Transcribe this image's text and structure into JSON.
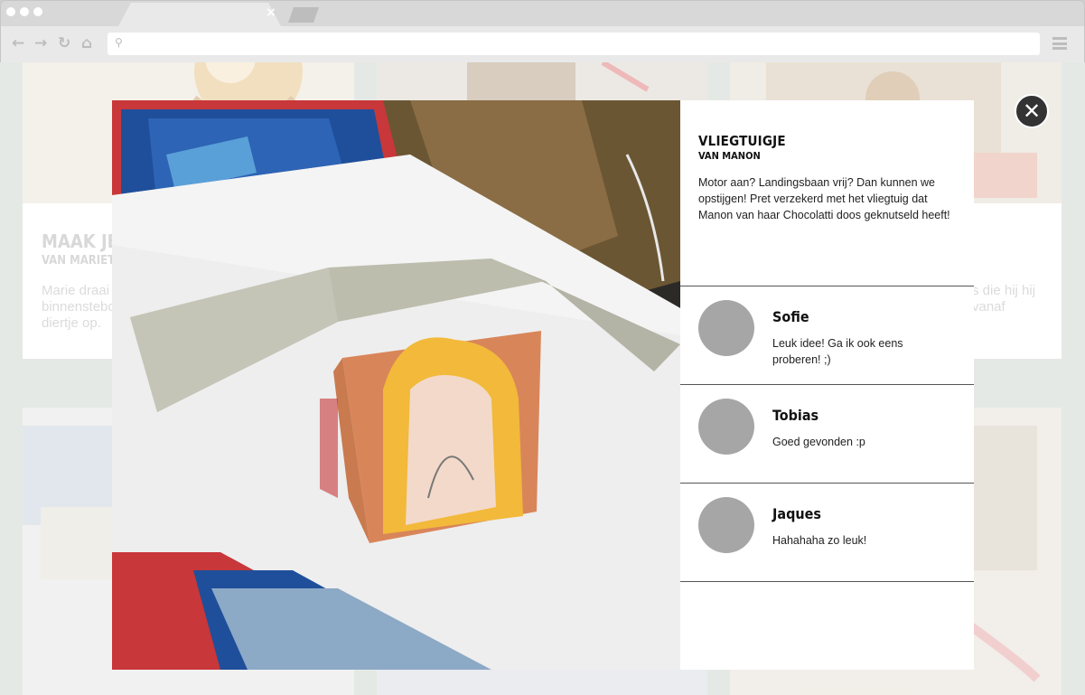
{
  "browser": {
    "tab_close_glyph": "×",
    "address_value": "",
    "nav_icons": [
      "back-icon",
      "forward-icon",
      "reload-icon",
      "home-icon"
    ]
  },
  "background": {
    "cards": [
      {
        "title": "Maak je v",
        "author": "van Marietje",
        "text": "Marie draai binnenstebo diertje op."
      },
      {
        "title": "",
        "author": "",
        "text": "s die hij hij vanaf"
      }
    ]
  },
  "modal": {
    "title": "Vliegtuigje",
    "author": "van Manon",
    "description": "Motor aan? Landingsbaan vrij? Dan kunnen we opstijgen! Pret verzekerd met het vliegtuig dat Manon van haar Chocolatti doos geknutseld heeft!",
    "close_glyph": "✕",
    "comments": [
      {
        "name": "Sofie",
        "text": "Leuk idee! Ga ik ook eens proberen! ;)"
      },
      {
        "name": "Tobias",
        "text": "Goed gevonden :p"
      },
      {
        "name": "Jaques",
        "text": "Hahahaha zo leuk!"
      }
    ]
  },
  "colors": {
    "page_background": "#cfd8cf",
    "avatar": "#a6a6a6",
    "close_button": "#333333"
  }
}
